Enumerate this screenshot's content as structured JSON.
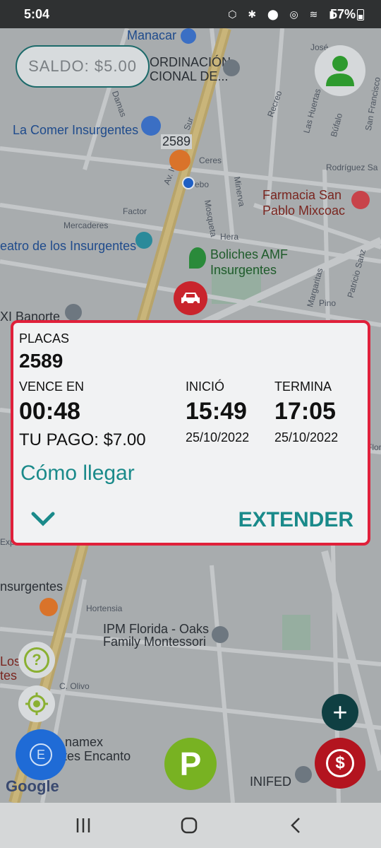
{
  "status": {
    "time": "5:04",
    "icons": "⬡ ✱ ⬤ ◎ ≋ ▮",
    "battery": "57%"
  },
  "map": {
    "labels": {
      "manacar": "Manacar",
      "coordinacion_1": "ORDINACIÓN",
      "coordinacion_2": "CIONAL DE...",
      "la_comer": "La Comer Insurgentes",
      "marker_2589": "2589",
      "farmacia_1": "Farmacia San",
      "farmacia_2": "Pablo Mixcoac",
      "teatro": "eatro de los Insurgentes",
      "boliches_1": "Boliches AMF",
      "boliches_2": "Insurgentes",
      "banorte": "XI Banorte",
      "ipm_1": "IPM Florida - Oaks",
      "ipm_2": "Family Montessori",
      "insurgentes_left": "nsurgentes",
      "los": "Los",
      "tes": "tes",
      "namex": "namex",
      "encanto": "entes Encanto",
      "inifed": "INIFED",
      "google": "Google",
      "streets": {
        "damas": "Damas",
        "recreo": "Recreo",
        "las_huertas": "Las Huertas",
        "bufalo": "Búfalo",
        "san_francisco": "San Francisco",
        "jose": "José",
        "rodriguez": "Rodríguez Sa",
        "ceres": "Ceres",
        "factor": "Factor",
        "mercaderes": "Mercaderes",
        "mosqueta": "Mosqueta",
        "minerva": "Minerva",
        "hera": "Hera",
        "margaritas": "Margaritas",
        "patricio_sanz": "Patricio Sanz",
        "pino": "Pino",
        "hortensia": "Hortensia",
        "c_olivo": "C. Olivo",
        "av_in": "Av. In",
        "sur": "Sur",
        "ebo": "ebo",
        "florida": "Florida",
        "exp": "Exp"
      }
    }
  },
  "saldo": {
    "label": "SALDO: $5.00"
  },
  "card": {
    "placas_label": "PLACAS",
    "placas_value": "2589",
    "vence_label": "VENCE EN",
    "vence_value": "00:48",
    "pago_label": "TU PAGO: $7.00",
    "inicio_label": "INICIÓ",
    "inicio_time": "15:49",
    "inicio_date": "25/10/2022",
    "termina_label": "TERMINA",
    "termina_time": "17:05",
    "termina_date": "25/10/2022",
    "how_to": "Cómo llegar",
    "extend": "EXTENDER"
  },
  "fabs": {
    "help": "?",
    "p_label": "P",
    "e_label": "E",
    "add": "+",
    "dollar": "$"
  },
  "colors": {
    "accent": "#1a8a8a",
    "card_border": "#e0203a",
    "pay_fab": "#b3141f",
    "parking_fab": "#78b222",
    "e_fab": "#1f6bd6",
    "add_fab": "#0f3f42"
  }
}
